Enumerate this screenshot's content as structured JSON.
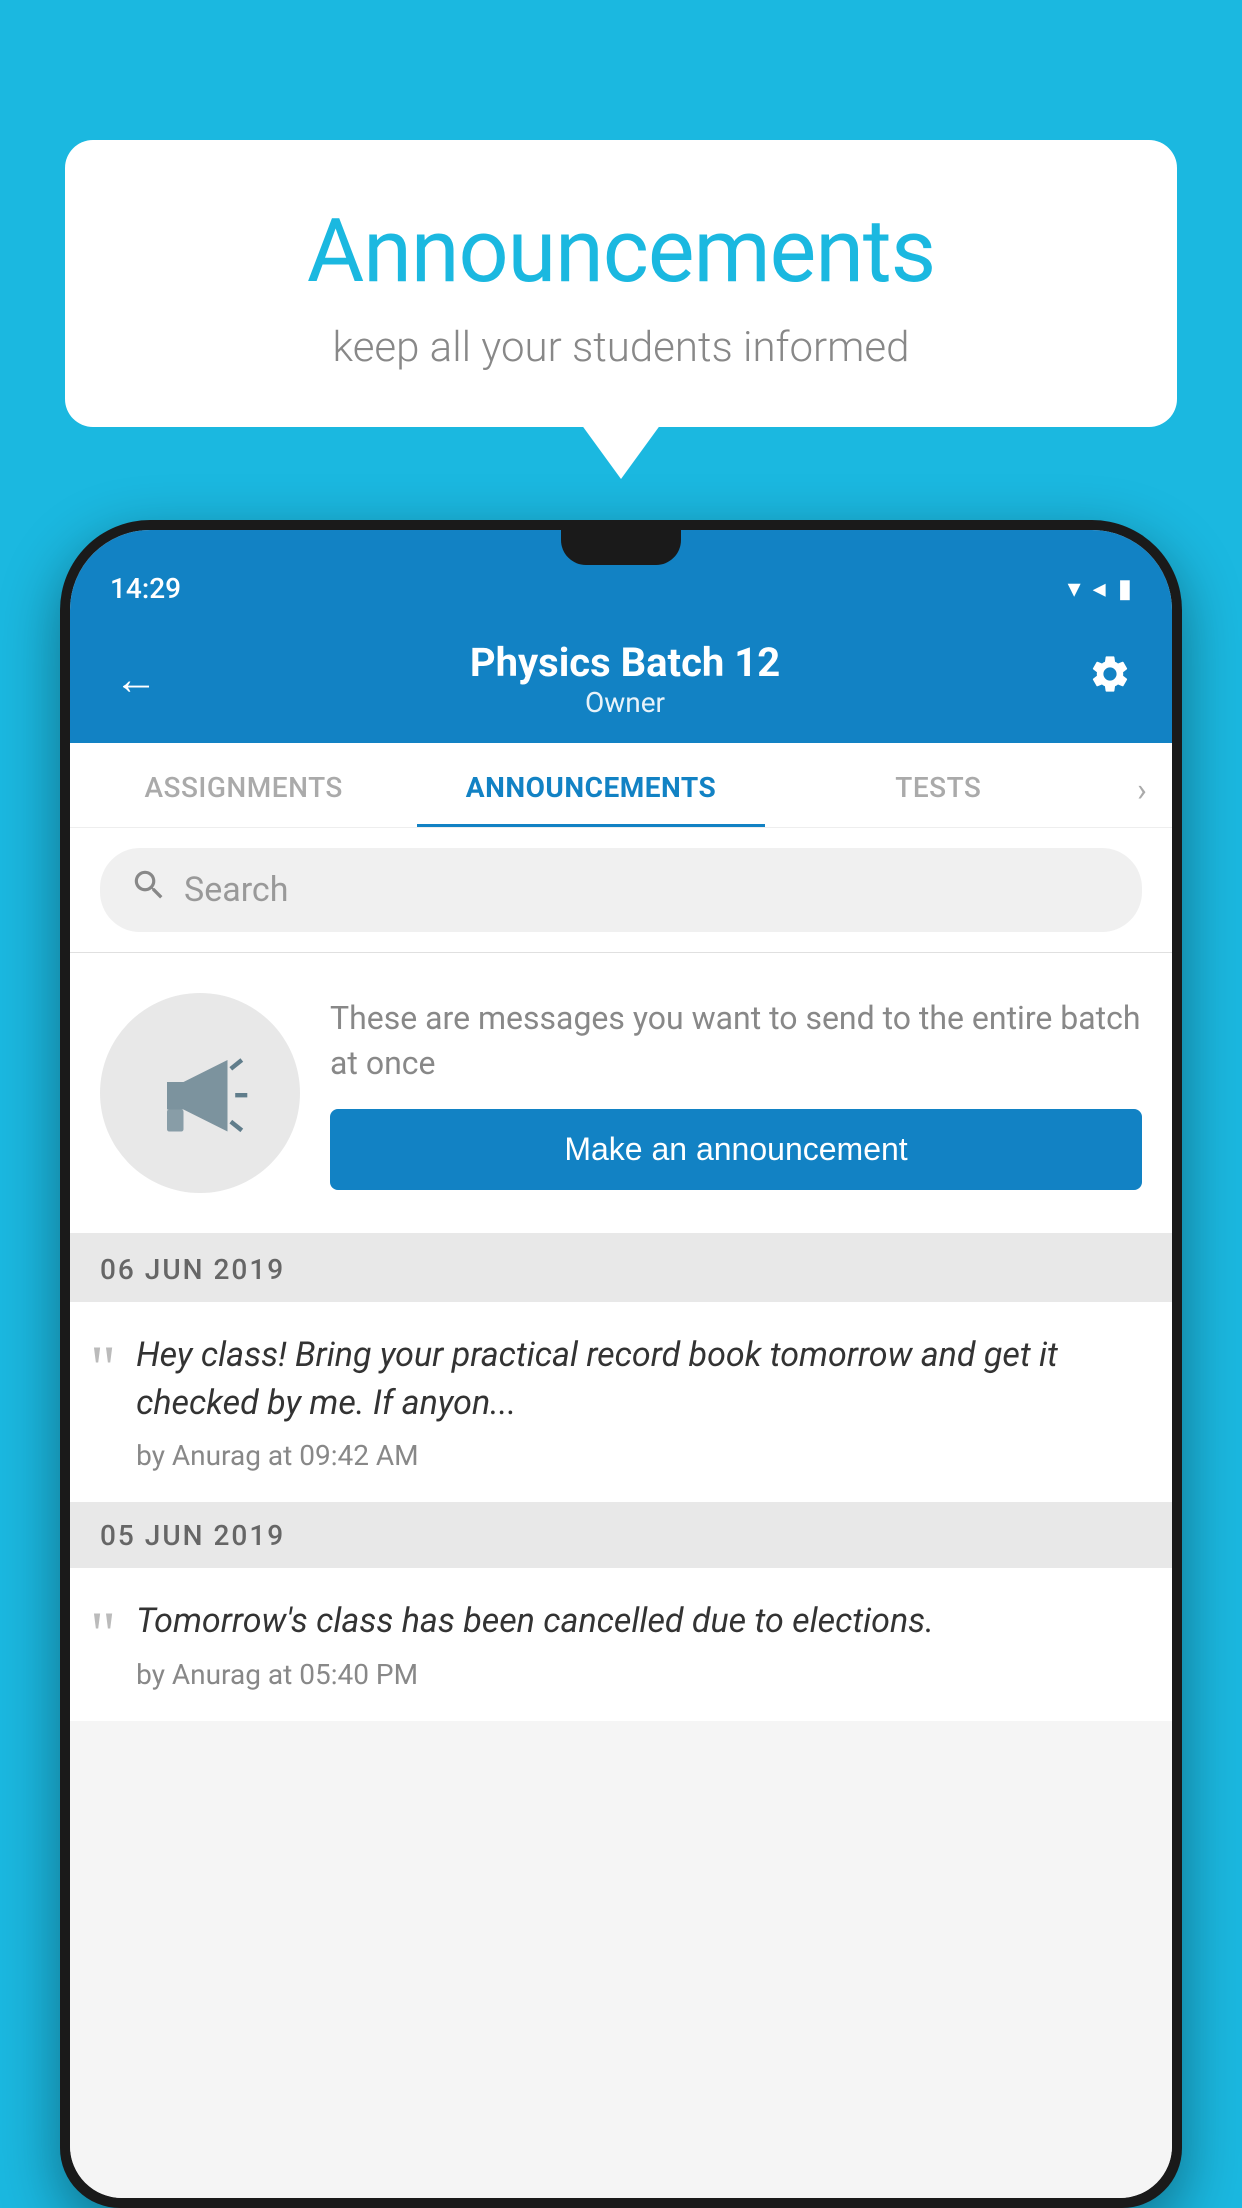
{
  "background": {
    "color": "#1bb8e0"
  },
  "speech_bubble": {
    "title": "Announcements",
    "subtitle": "keep all your students informed"
  },
  "status_bar": {
    "time": "14:29",
    "wifi": "▼",
    "signal": "▲",
    "battery": "▮"
  },
  "app_bar": {
    "title": "Physics Batch 12",
    "subtitle": "Owner",
    "back_label": "←",
    "settings_label": "⚙"
  },
  "tabs": [
    {
      "label": "ASSIGNMENTS",
      "active": false
    },
    {
      "label": "ANNOUNCEMENTS",
      "active": true
    },
    {
      "label": "TESTS",
      "active": false
    }
  ],
  "tabs_more": "›",
  "search": {
    "placeholder": "Search"
  },
  "announcement_prompt": {
    "description": "These are messages you want to send to the entire batch at once",
    "button_label": "Make an announcement"
  },
  "date_groups": [
    {
      "date": "06  JUN  2019",
      "announcements": [
        {
          "text": "Hey class! Bring your practical record book tomorrow and get it checked by me. If anyon...",
          "meta": "by Anurag at 09:42 AM"
        }
      ]
    },
    {
      "date": "05  JUN  2019",
      "announcements": [
        {
          "text": "Tomorrow's class has been cancelled due to elections.",
          "meta": "by Anurag at 05:40 PM"
        }
      ]
    }
  ]
}
